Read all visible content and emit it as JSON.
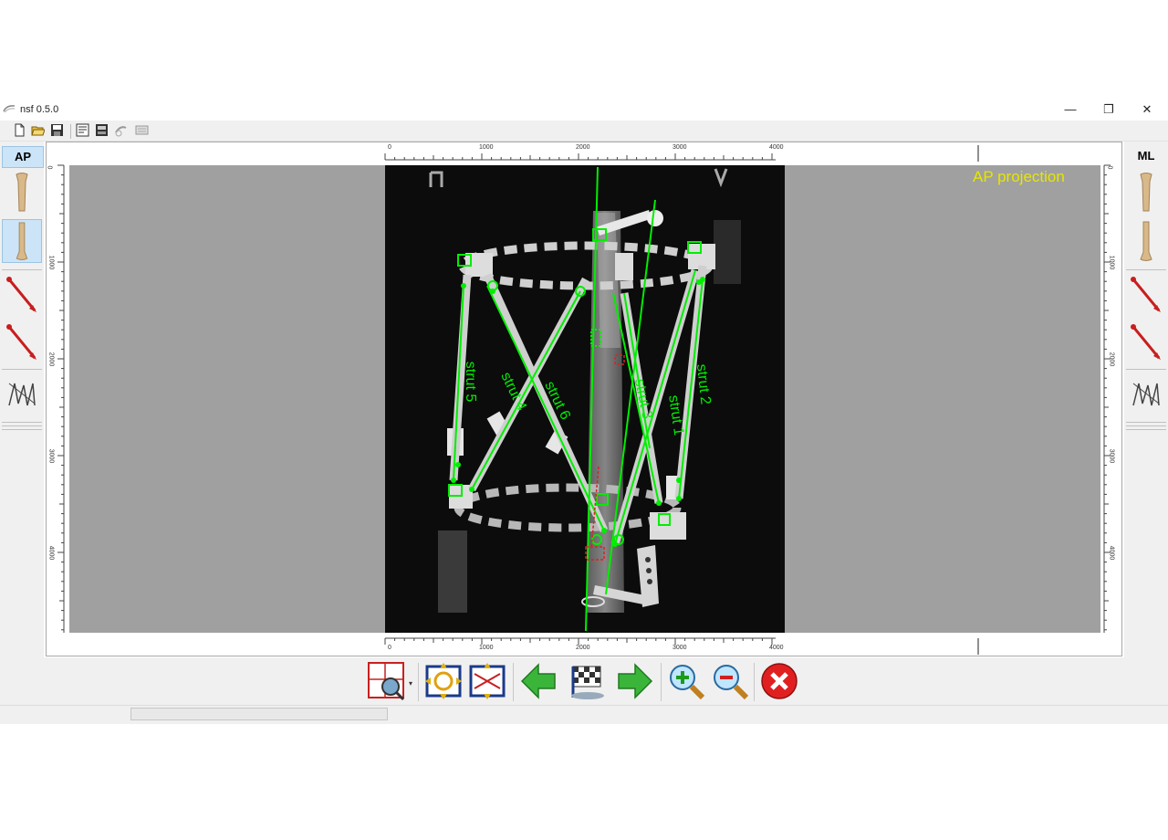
{
  "window": {
    "title": "nsf 0.5.0",
    "controls": {
      "minimize": "—",
      "restore": "❐",
      "close": "✕"
    }
  },
  "toolbar": {
    "icons": [
      "new-file-icon",
      "open-folder-icon",
      "save-icon",
      "report-icon",
      "print-icon",
      "export-icon",
      "settings-icon"
    ]
  },
  "left_panel": {
    "tab_label": "AP"
  },
  "right_panel": {
    "tab_label": "ML"
  },
  "view": {
    "projection_label": "AP projection",
    "ruler_top": [
      "0",
      "1000",
      "2000",
      "3000",
      "4000"
    ],
    "ruler_bottom": [
      "0",
      "1000",
      "2000",
      "3000",
      "4000"
    ],
    "ruler_left": [
      "0",
      "1000",
      "2000",
      "3000",
      "4000"
    ],
    "ruler_right": [
      "0",
      "1000",
      "2000",
      "3000",
      "4000"
    ],
    "struts": [
      "strut 1",
      "strut 2",
      "strut 3",
      "strut 4",
      "strut 5",
      "strut 6"
    ]
  },
  "colors": {
    "overlay": "#00ee00",
    "projection_label": "#e6e600",
    "viewport_bg": "#a0a0a0",
    "accent_arrow": "#3ab53a",
    "close_red": "#e02020"
  },
  "bottom_toolbar": {
    "icons": [
      "select-region-icon",
      "fit-frame-icon",
      "fit-ring-icon",
      "previous-arrow-icon",
      "finish-flag-icon",
      "next-arrow-icon",
      "zoom-in-icon",
      "zoom-out-icon",
      "cancel-icon"
    ]
  }
}
